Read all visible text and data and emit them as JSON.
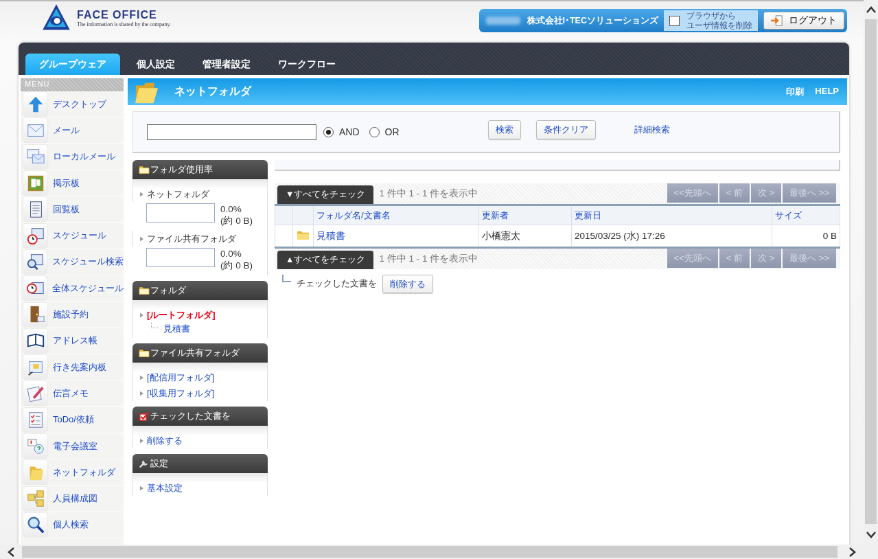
{
  "header": {
    "logo": {
      "name": "FACE OFFICE",
      "tagline": "The information is shared by the company."
    },
    "user_bar": {
      "company": "株式会社I･TECソリューションズ",
      "clear_option": {
        "label_lines": [
          "ブラウザから",
          "ユーザ情報を削除"
        ],
        "checked": false
      },
      "logout": "ログアウト"
    }
  },
  "nav_tabs": [
    {
      "label": "グループウェア",
      "selected": true
    },
    {
      "label": "個人設定",
      "selected": false
    },
    {
      "label": "管理者設定",
      "selected": false
    },
    {
      "label": "ワークフロー",
      "selected": false
    }
  ],
  "menu": {
    "title": "MENU",
    "items": [
      {
        "label": "デスクトップ"
      },
      {
        "label": "メール"
      },
      {
        "label": "ローカルメール"
      },
      {
        "label": "掲示板"
      },
      {
        "label": "回覧板"
      },
      {
        "label": "スケジュール"
      },
      {
        "label": "スケジュール検索"
      },
      {
        "label": "全体スケジュール"
      },
      {
        "label": "施設予約"
      },
      {
        "label": "アドレス帳"
      },
      {
        "label": "行き先案内板"
      },
      {
        "label": "伝言メモ"
      },
      {
        "label": "ToDo/依頼"
      },
      {
        "label": "電子会議室"
      },
      {
        "label": "ネットフォルダ"
      },
      {
        "label": "人員構成図"
      },
      {
        "label": "個人検索"
      }
    ]
  },
  "page_header": {
    "title": "ネットフォルダ",
    "links": [
      "印刷",
      "HELP"
    ]
  },
  "search": {
    "modes": [
      {
        "label": "AND",
        "selected": true
      },
      {
        "label": "OR",
        "selected": false
      }
    ],
    "buttons": [
      "検索",
      "条件クリア"
    ],
    "advanced_link": "詳細検索"
  },
  "side_panels": [
    {
      "title": "フォルダ使用率",
      "kind": "folder",
      "items": [
        {
          "kind": "usage",
          "label": "ネットフォルダ",
          "level": 0,
          "reading": "0.0%",
          "detail": "(約 0 B)"
        },
        {
          "kind": "usage",
          "label": "ファイル共有フォルダ",
          "level": 0,
          "reading": "0.0%",
          "detail": "(約 0 B)"
        }
      ]
    },
    {
      "title": "フォルダ",
      "kind": "folder",
      "items": [
        {
          "kind": "link",
          "label": "[ルートフォルダ]",
          "current": true,
          "children": [
            {
              "label": "見積書"
            }
          ]
        }
      ]
    },
    {
      "title": "ファイル共有フォルダ",
      "kind": "folder",
      "items": [
        {
          "kind": "link",
          "label": "[配信用フォルダ]",
          "current": false
        },
        {
          "kind": "link",
          "label": "[収集用フォルダ]",
          "current": false
        }
      ]
    },
    {
      "title": "チェックした文書を",
      "kind": "check",
      "items": [
        {
          "kind": "link",
          "label": "削除する",
          "current": false
        }
      ]
    },
    {
      "title": "設定",
      "kind": "wrench",
      "items": [
        {
          "kind": "link",
          "label": "基本設定",
          "current": false
        }
      ]
    }
  ],
  "table": {
    "top_bar": {
      "check_all": "▼すべてをチェック",
      "count": "1 件中 1 - 1 件を表示中",
      "pager": [
        {
          "label": "<<先頭へ",
          "disabled": true
        },
        {
          "label": "< 前",
          "disabled": true
        },
        {
          "label": "次 >",
          "disabled": true
        },
        {
          "label": "最後へ >>",
          "disabled": true
        }
      ]
    },
    "columns": [
      "フォルダ名/文書名",
      "更新者",
      "更新日",
      "サイズ"
    ],
    "rows": [
      {
        "kind": "folder",
        "name": "見積書",
        "updated_by": "小橋憲太",
        "updated_at": "2015/03/25 (水) 17:26",
        "size": "0 B"
      }
    ],
    "bottom_bar": {
      "check_all": "▲すべてをチェック",
      "count": "1 件中 1 - 1 件を表示中",
      "pager": [
        {
          "label": "<<先頭へ",
          "disabled": true
        },
        {
          "label": "< 前",
          "disabled": true
        },
        {
          "label": "次 >",
          "disabled": true
        },
        {
          "label": "最後へ >>",
          "disabled": true
        }
      ]
    },
    "action": {
      "label": "チェックした文書を",
      "button": "削除する"
    }
  }
}
